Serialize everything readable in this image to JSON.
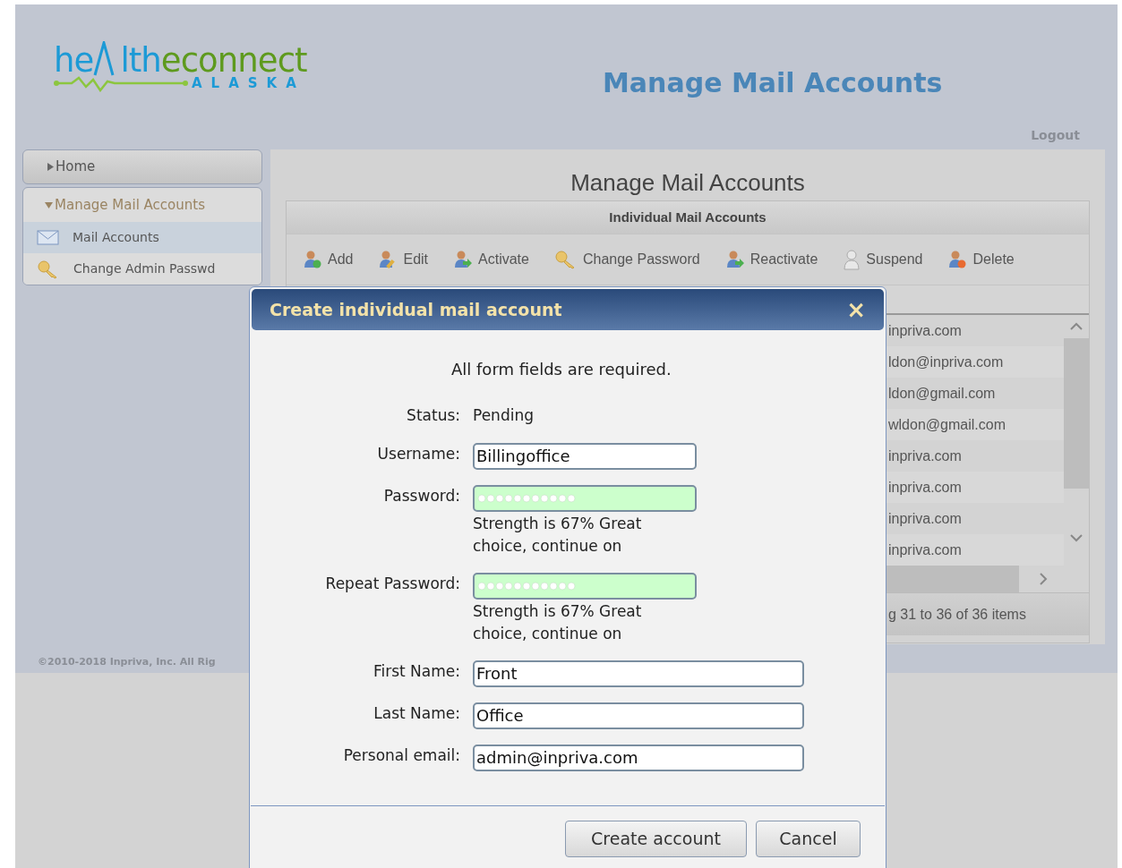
{
  "logo": {
    "part_1": "he",
    "part_2": "lth",
    "part_3": "econnect",
    "tagline": "ALASKA"
  },
  "header": {
    "title": "Manage Mail Accounts",
    "logout": "Logout"
  },
  "sidebar": {
    "home": "Home",
    "group": {
      "label": "Manage Mail Accounts",
      "expanded": true
    },
    "items": [
      {
        "label": "Mail Accounts",
        "selected": true
      },
      {
        "label": "Change Admin Passwd",
        "selected": false
      }
    ]
  },
  "main": {
    "title": "Manage Mail Accounts",
    "grid_title": "Individual Mail Accounts",
    "toolbar": [
      "Add",
      "Edit",
      "Activate",
      "Change Password",
      "Reactivate",
      "Suspend",
      "Delete"
    ],
    "rows": [
      {
        "email": "inpriva.com"
      },
      {
        "email": "ldon@inpriva.com"
      },
      {
        "email": "ldon@gmail.com"
      },
      {
        "email": "wldon@gmail.com"
      },
      {
        "email": "inpriva.com"
      },
      {
        "email": "inpriva.com"
      },
      {
        "email": "inpriva.com"
      },
      {
        "email": "inpriva.com"
      }
    ],
    "pager": "g 31 to 36 of 36 items"
  },
  "footer": "©2010-2018 Inpriva, Inc. All Rig",
  "dialog": {
    "title": "Create individual mail account",
    "close": "×",
    "note": "All form fields are required.",
    "status_label": "Status:",
    "status_value": "Pending",
    "fields": [
      {
        "kind": "text",
        "label": "Username:",
        "value": "Billingoffice",
        "wide": false
      },
      {
        "kind": "password",
        "label": "Password:",
        "valid": true,
        "strength": "Strength is 67% Great choice, continue on"
      },
      {
        "kind": "password",
        "label": "Repeat Password:",
        "valid": true,
        "strength": "Strength is 67% Great choice, continue on"
      },
      {
        "kind": "text",
        "label": "First Name:",
        "value": "Front",
        "wide": true
      },
      {
        "kind": "text",
        "label": "Last Name:",
        "value": "Office",
        "wide": true
      },
      {
        "kind": "text",
        "label": "Personal email:",
        "value": "admin@inpriva.com",
        "wide": true
      }
    ],
    "buttons": [
      "Create account",
      "Cancel"
    ]
  }
}
